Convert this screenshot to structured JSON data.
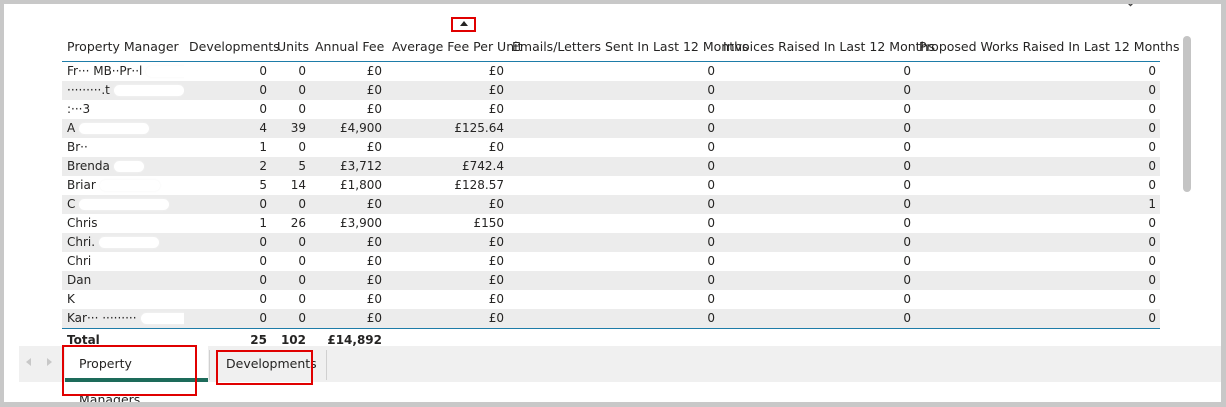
{
  "table": {
    "columns": [
      "Property Manager",
      "Developments",
      "Units",
      "Annual Fee",
      "Average Fee Per Unit",
      "Emails/Letters Sent In Last 12 Months",
      "Invoices Raised In Last 12 Months",
      "Proposed Works Raised In Last 12 Months"
    ],
    "rows": [
      {
        "name": "Fr··· MB··Pr··l",
        "developments": "0",
        "units": "0",
        "annual_fee": "£0",
        "avg_fee": "£0",
        "emails": "0",
        "invoices": "0",
        "works": "0"
      },
      {
        "name": "·········.t",
        "developments": "0",
        "units": "0",
        "annual_fee": "£0",
        "avg_fee": "£0",
        "emails": "0",
        "invoices": "0",
        "works": "0"
      },
      {
        "name": ":···3",
        "developments": "0",
        "units": "0",
        "annual_fee": "£0",
        "avg_fee": "£0",
        "emails": "0",
        "invoices": "0",
        "works": "0"
      },
      {
        "name": "A",
        "developments": "4",
        "units": "39",
        "annual_fee": "£4,900",
        "avg_fee": "£125.64",
        "emails": "0",
        "invoices": "0",
        "works": "0"
      },
      {
        "name": "Br··",
        "developments": "1",
        "units": "0",
        "annual_fee": "£0",
        "avg_fee": "£0",
        "emails": "0",
        "invoices": "0",
        "works": "0"
      },
      {
        "name": "Brenda",
        "developments": "2",
        "units": "5",
        "annual_fee": "£3,712",
        "avg_fee": "£742.4",
        "emails": "0",
        "invoices": "0",
        "works": "0"
      },
      {
        "name": "Briar",
        "developments": "5",
        "units": "14",
        "annual_fee": "£1,800",
        "avg_fee": "£128.57",
        "emails": "0",
        "invoices": "0",
        "works": "0"
      },
      {
        "name": "C",
        "developments": "0",
        "units": "0",
        "annual_fee": "£0",
        "avg_fee": "£0",
        "emails": "0",
        "invoices": "0",
        "works": "1"
      },
      {
        "name": "Chris",
        "developments": "1",
        "units": "26",
        "annual_fee": "£3,900",
        "avg_fee": "£150",
        "emails": "0",
        "invoices": "0",
        "works": "0"
      },
      {
        "name": "Chri.",
        "developments": "0",
        "units": "0",
        "annual_fee": "£0",
        "avg_fee": "£0",
        "emails": "0",
        "invoices": "0",
        "works": "0"
      },
      {
        "name": "Chri",
        "developments": "0",
        "units": "0",
        "annual_fee": "£0",
        "avg_fee": "£0",
        "emails": "0",
        "invoices": "0",
        "works": "0"
      },
      {
        "name": "Dan",
        "developments": "0",
        "units": "0",
        "annual_fee": "£0",
        "avg_fee": "£0",
        "emails": "0",
        "invoices": "0",
        "works": "0"
      },
      {
        "name": "K",
        "developments": "0",
        "units": "0",
        "annual_fee": "£0",
        "avg_fee": "£0",
        "emails": "0",
        "invoices": "0",
        "works": "0"
      },
      {
        "name": "Kar··· ·········",
        "developments": "0",
        "units": "0",
        "annual_fee": "£0",
        "avg_fee": "£0",
        "emails": "0",
        "invoices": "0",
        "works": "0"
      }
    ],
    "total": {
      "label": "Total",
      "developments": "25",
      "units": "102",
      "annual_fee": "£14,892"
    }
  },
  "tabs": [
    {
      "label": "Property Managers",
      "active": true
    },
    {
      "label": "Developments",
      "active": false
    }
  ],
  "colors": {
    "accent_line": "#1e7ca8",
    "tab_underline": "#1d6b5a",
    "highlight": "#e00000",
    "alt_row": "#ececec"
  },
  "icons": {
    "sort": "sort-ascending-icon",
    "scroll_left": "scroll-left-icon",
    "scroll_right": "scroll-right-icon",
    "corner": "chevron-down-icon"
  }
}
